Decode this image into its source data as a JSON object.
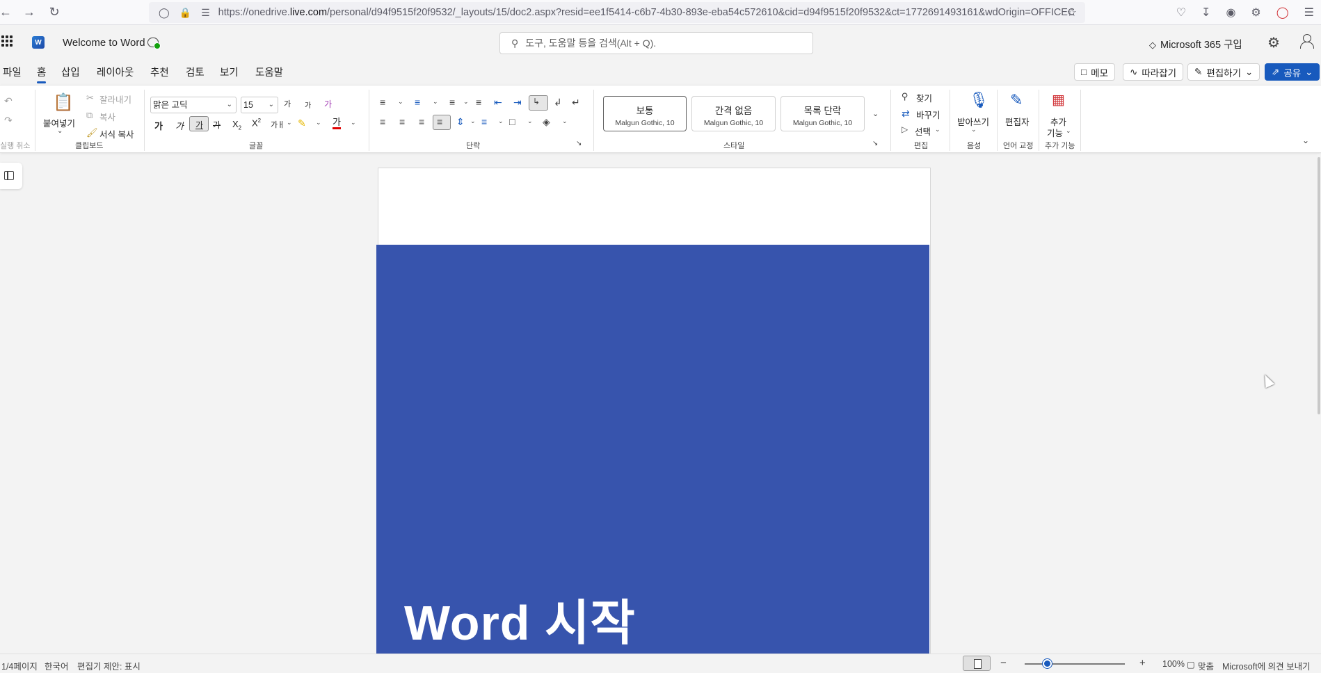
{
  "browser": {
    "url_prefix": "https://onedrive.",
    "url_domain": "live.com",
    "url_suffix": "/personal/d94f9515f20f9532/_layouts/15/doc2.aspx?resid=ee1f5414-c6b7-4b30-893e-eba54c572610&cid=d94f9515f20f9532&ct=1772691493161&wdOrigin=OFFICECOM-"
  },
  "titlebar": {
    "doc_title": "Welcome to Word",
    "search_placeholder": "도구, 도움말 등을 검색(Alt + Q).",
    "m365_label": "Microsoft 365 구입"
  },
  "menu": {
    "tabs": [
      "파일",
      "홈",
      "삽입",
      "레이아웃",
      "추천",
      "검토",
      "보기",
      "도움말"
    ],
    "active_tab": "홈",
    "comment_label": "메모",
    "catchup_label": "따라잡기",
    "editing_label": "편집하기",
    "share_label": "공유"
  },
  "ribbon": {
    "undo_group_label": "실행 취소",
    "paste_label": "붙여넣기",
    "cut_label": "잘라내기",
    "copy_label": "복사",
    "format_painter_label": "서식 복사",
    "clipboard_label": "클립보드",
    "font_name": "맑은 고딕",
    "font_size": "15",
    "grow_font": "가",
    "shrink_font": "가",
    "clear_format": "가",
    "bold": "가",
    "italic": "가",
    "underline": "가",
    "strike": "가",
    "subscript": "X",
    "superscript": "X",
    "case": "가ㅐ",
    "font_color": "가",
    "font_group_label": "글꼴",
    "paragraph_group_label": "단락",
    "styles": [
      {
        "name": "보통",
        "font": "Malgun Gothic, 10"
      },
      {
        "name": "간격 없음",
        "font": "Malgun Gothic, 10"
      },
      {
        "name": "목록 단락",
        "font": "Malgun Gothic, 10"
      }
    ],
    "styles_group_label": "스타일",
    "find_label": "찾기",
    "replace_label": "바꾸기",
    "select_label": "선택",
    "editing_group_label": "편집",
    "dictate_label": "받아쓰기",
    "voice_group_label": "음성",
    "editor_label": "편집자",
    "proofing_group_label": "언어 교정",
    "addins_label_1": "추가",
    "addins_label_2": "기능",
    "addins_group_label": "추가 기능"
  },
  "document": {
    "cover_title": "Word  시작",
    "cover_color": "#3754ad"
  },
  "status": {
    "page_info": "1/4페이지",
    "language": "한국어",
    "editor_suggestions": "편집기 제안: 표시",
    "zoom_level_text": "100%",
    "zoom_level": 25,
    "fit_label": "맞춤",
    "feedback_label": "Microsoft에 의견 보내기"
  },
  "colors": {
    "accent": "#185abd"
  }
}
